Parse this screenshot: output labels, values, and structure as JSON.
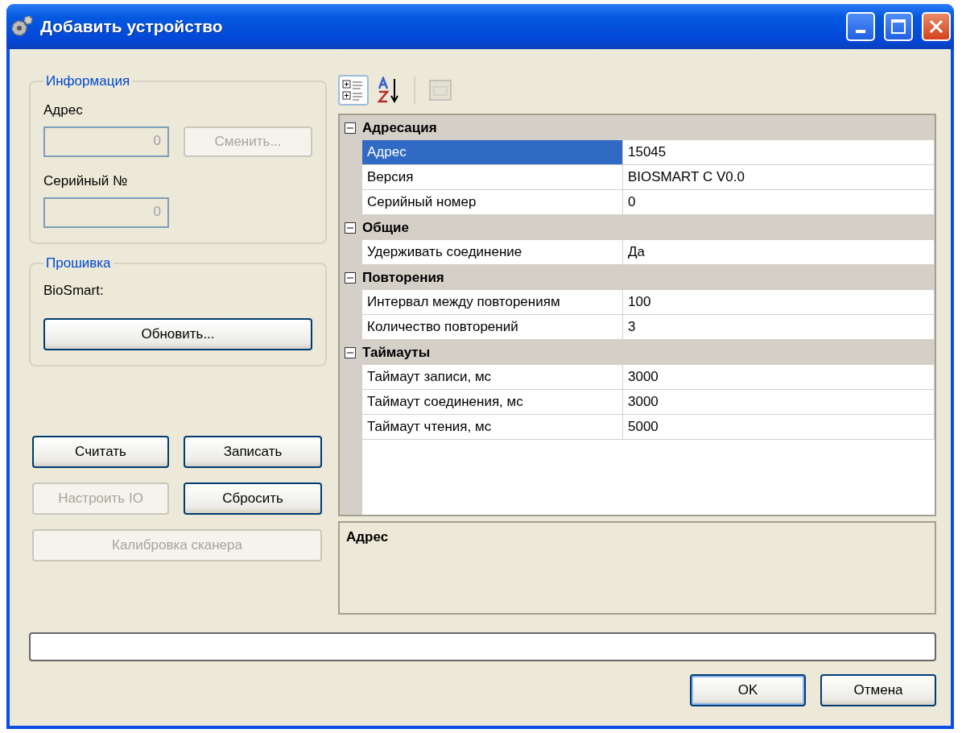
{
  "window": {
    "title": "Добавить устройство"
  },
  "info_group": {
    "title": "Информация",
    "address_label": "Адрес",
    "address_value": "0",
    "change_button": {
      "label": "Сменить...",
      "disabled": true
    },
    "serial_label": "Серийный №",
    "serial_value": "0"
  },
  "firmware_group": {
    "title": "Прошивка",
    "device_label": "BioSmart:",
    "update_button": {
      "label": "Обновить...",
      "disabled": false
    }
  },
  "action_buttons": [
    {
      "label": "Считать",
      "disabled": false
    },
    {
      "label": "Записать",
      "disabled": false
    },
    {
      "label": "Настроить IO",
      "disabled": true
    },
    {
      "label": "Сбросить",
      "disabled": false
    },
    {
      "label": "Калибровка сканера",
      "disabled": true
    }
  ],
  "toolbar": [
    {
      "kind": "categorized",
      "selected": true,
      "disabled": false
    },
    {
      "kind": "alphabetical",
      "selected": false,
      "disabled": false
    },
    {
      "kind": "pages",
      "selected": false,
      "disabled": true
    }
  ],
  "property_grid": [
    {
      "category": "Адресация",
      "expanded": true,
      "rows": [
        {
          "name": "Адрес",
          "value": "15045",
          "selected": true
        },
        {
          "name": "Версия",
          "value": "BIOSMART C V0.0",
          "selected": false
        },
        {
          "name": "Серийный номер",
          "value": "0",
          "selected": false
        }
      ]
    },
    {
      "category": "Общие",
      "expanded": true,
      "rows": [
        {
          "name": "Удерживать соединение",
          "value": "Да",
          "selected": false
        }
      ]
    },
    {
      "category": "Повторения",
      "expanded": true,
      "rows": [
        {
          "name": "Интервал между повторениям",
          "value": "100",
          "selected": false
        },
        {
          "name": "Количество повторений",
          "value": "3",
          "selected": false
        }
      ]
    },
    {
      "category": "Таймауты",
      "expanded": true,
      "rows": [
        {
          "name": "Таймаут записи, мс",
          "value": "3000",
          "selected": false
        },
        {
          "name": "Таймаут соединения, мс",
          "value": "3000",
          "selected": false
        },
        {
          "name": "Таймаут чтения, мс",
          "value": "5000",
          "selected": false
        }
      ]
    }
  ],
  "help": {
    "title": "Адрес"
  },
  "progress": {
    "level": 0
  },
  "dialog_buttons": [
    {
      "label": "OK",
      "default": true
    },
    {
      "label": "Отмена",
      "default": false
    }
  ]
}
